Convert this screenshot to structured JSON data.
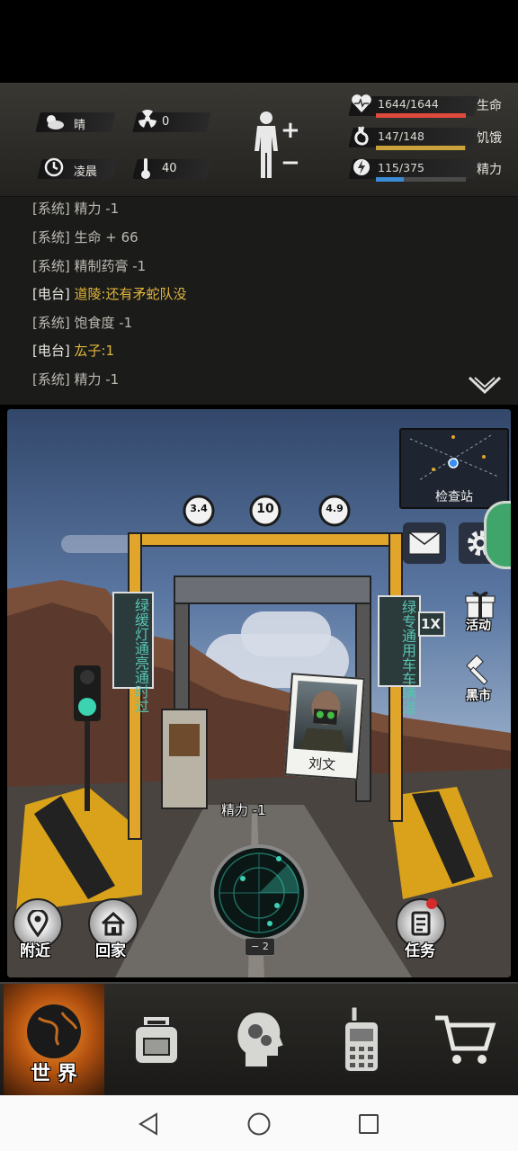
{
  "status": {
    "weather": "晴",
    "radiation": "0",
    "time_of_day": "凌晨",
    "temperature": "40",
    "health_text": "1644/1644",
    "health_label": "生命",
    "health_fraction": 1.0,
    "hunger_text": "147/148",
    "hunger_label": "饥饿",
    "hunger_fraction": 0.99,
    "energy_text": "115/375",
    "energy_label": "精力",
    "energy_fraction": 0.31
  },
  "log": [
    {
      "tag": "[系统]",
      "text": "精力 -1",
      "type": "sys"
    },
    {
      "tag": "[系统]",
      "text": "生命 + 66",
      "type": "sys"
    },
    {
      "tag": "[系统]",
      "text": "精制药膏 -1",
      "type": "sys"
    },
    {
      "tag": "[电台]",
      "text": "道陵:还有矛蛇队没",
      "type": "radio"
    },
    {
      "tag": "[系统]",
      "text": "饱食度 -1",
      "type": "sys"
    },
    {
      "tag": "[电台]",
      "text": "厷子:1",
      "type": "radio"
    },
    {
      "tag": "[系统]",
      "text": "精力 -1",
      "type": "sys"
    }
  ],
  "scene": {
    "location_name": "检查站",
    "signs": {
      "sign1": "3.4",
      "sign2": "10",
      "sign3": "4.9",
      "left_board": "绿缓灯通亮通时过",
      "right_board": "绿专通用车车辆道",
      "limit_sign": "1X"
    },
    "npc_name": "刘文",
    "floating_text": "精力 -1",
    "radar_counter": "2",
    "side_buttons": {
      "events": "活动",
      "black_market": "黑市"
    },
    "bottom_buttons": {
      "nearby": "附近",
      "home": "回家",
      "quests": "任务"
    }
  },
  "bottom_nav": {
    "world": "世 界"
  },
  "colors": {
    "health": "#e04a3c",
    "hunger": "#c9a23c",
    "energy": "#3c8bd6",
    "radio_text": "#e0b63c"
  }
}
